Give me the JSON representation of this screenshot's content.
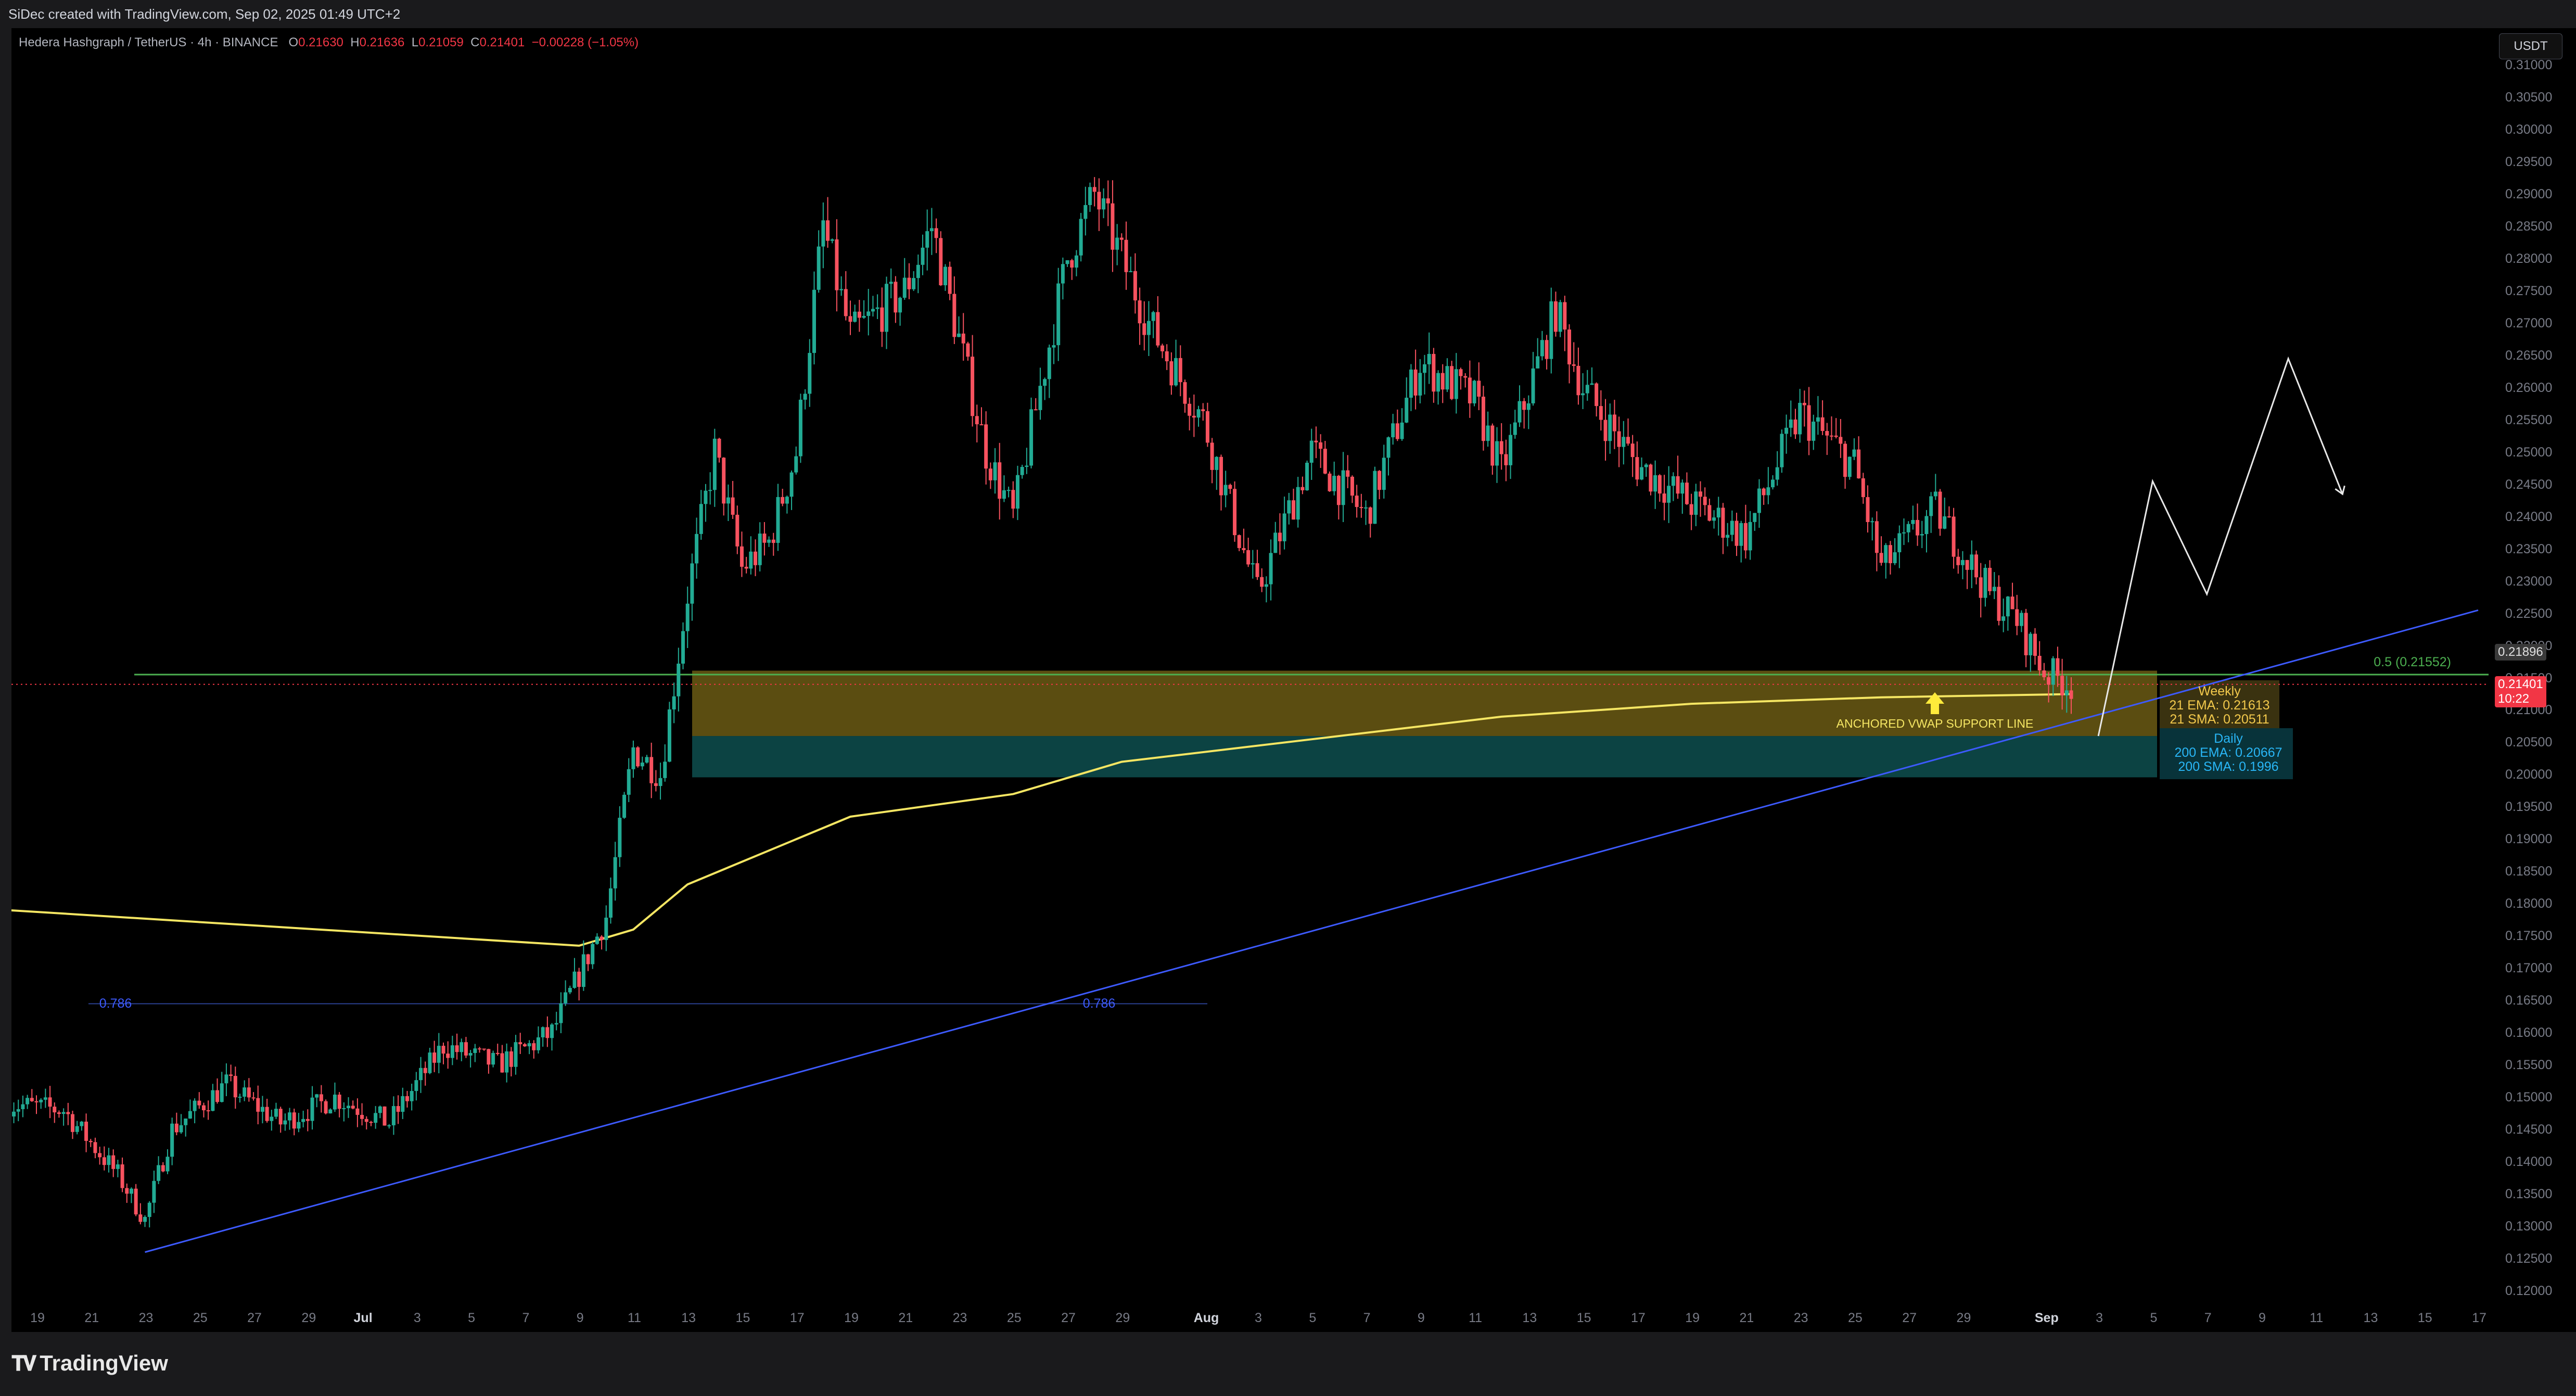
{
  "header": {
    "credit": "SiDec created with TradingView.com, Sep 02, 2025 01:49 UTC+2"
  },
  "symbol": {
    "title": "Hedera Hashgraph / TetherUS · 4h · BINANCE",
    "o_label": "O",
    "o": "0.21630",
    "h_label": "H",
    "h": "0.21636",
    "l_label": "L",
    "l": "0.21059",
    "c_label": "C",
    "c": "0.21401",
    "change": "−0.00228 (−1.05%)"
  },
  "price_axis": {
    "currency": "USDT",
    "ticks": [
      "0.31000",
      "0.30500",
      "0.30000",
      "0.29500",
      "0.29000",
      "0.28500",
      "0.28000",
      "0.27500",
      "0.27000",
      "0.26500",
      "0.26000",
      "0.25500",
      "0.25000",
      "0.24500",
      "0.24000",
      "0.23500",
      "0.23000",
      "0.22500",
      "0.22000",
      "0.21500",
      "0.21000",
      "0.20500",
      "0.20000",
      "0.19500",
      "0.19000",
      "0.18500",
      "0.18000",
      "0.17500",
      "0.17000",
      "0.16500",
      "0.16000",
      "0.15500",
      "0.15000",
      "0.14500",
      "0.14000",
      "0.13500",
      "0.13000",
      "0.12500",
      "0.12000"
    ],
    "marker_level": "0.21896",
    "marker_last": "0.21401",
    "marker_countdown": "10:22"
  },
  "time_axis": {
    "ticks": [
      "19",
      "21",
      "23",
      "25",
      "27",
      "29",
      "Jul",
      "3",
      "5",
      "7",
      "9",
      "11",
      "13",
      "15",
      "17",
      "19",
      "21",
      "23",
      "25",
      "27",
      "29",
      "Aug",
      "3",
      "5",
      "7",
      "9",
      "11",
      "13",
      "15",
      "17",
      "19",
      "21",
      "23",
      "25",
      "27",
      "29",
      "Sep",
      "3",
      "5",
      "7",
      "9",
      "11",
      "13",
      "15",
      "17"
    ]
  },
  "annotations": {
    "fib_label": "0.5 (0.21552)",
    "weekly_title": "Weekly",
    "weekly_ema": "21 EMA: 0.21613",
    "weekly_sma": "21 SMA: 0.20511",
    "daily_title": "Daily",
    "daily_ema": "200 EMA: 0.20667",
    "daily_sma": "200 SMA: 0.1996",
    "vwap_label": "ANCHORED VWAP SUPPORT LINE",
    "fib_786_left": "0.786",
    "fib_786_mid": "0.786"
  },
  "colors": {
    "bull": "#22ab94",
    "bear": "#f7525f",
    "vwap": "#f5e663",
    "trendline": "#3d5afe",
    "fib_green": "#4caf50",
    "weekly_zone": "#6b5a14",
    "daily_zone": "#0d4a4a",
    "background": "#000000"
  },
  "footer": {
    "brand": "TradingView",
    "brand_icon": "tradingview-logo-icon"
  },
  "chart_data": {
    "type": "candlestick",
    "title": "Hedera Hashgraph / TetherUS · 4h · BINANCE",
    "ylim": [
      0.118,
      0.312
    ],
    "x_range": [
      "2025-06-18",
      "2025-09-17"
    ],
    "close_path": [
      [
        "2025-06-18",
        0.149
      ],
      [
        "2025-06-20",
        0.148
      ],
      [
        "2025-06-22",
        0.138
      ],
      [
        "2025-06-23",
        0.131
      ],
      [
        "2025-06-24",
        0.145
      ],
      [
        "2025-06-26",
        0.152
      ],
      [
        "2025-06-28",
        0.146
      ],
      [
        "2025-06-30",
        0.15
      ],
      [
        "2025-07-02",
        0.146
      ],
      [
        "2025-07-04",
        0.158
      ],
      [
        "2025-07-06",
        0.155
      ],
      [
        "2025-07-08",
        0.16
      ],
      [
        "2025-07-10",
        0.178
      ],
      [
        "2025-07-11",
        0.204
      ],
      [
        "2025-07-12",
        0.2
      ],
      [
        "2025-07-13",
        0.228
      ],
      [
        "2025-07-14",
        0.25
      ],
      [
        "2025-07-15",
        0.232
      ],
      [
        "2025-07-16",
        0.236
      ],
      [
        "2025-07-17",
        0.25
      ],
      [
        "2025-07-18",
        0.285
      ],
      [
        "2025-07-19",
        0.268
      ],
      [
        "2025-07-21",
        0.275
      ],
      [
        "2025-07-22",
        0.285
      ],
      [
        "2025-07-24",
        0.25
      ],
      [
        "2025-07-25",
        0.24
      ],
      [
        "2025-07-27",
        0.28
      ],
      [
        "2025-07-28",
        0.29
      ],
      [
        "2025-07-30",
        0.27
      ],
      [
        "2025-08-01",
        0.255
      ],
      [
        "2025-08-03",
        0.228
      ],
      [
        "2025-08-05",
        0.25
      ],
      [
        "2025-08-07",
        0.24
      ],
      [
        "2025-08-09",
        0.264
      ],
      [
        "2025-08-11",
        0.258
      ],
      [
        "2025-08-12",
        0.247
      ],
      [
        "2025-08-14",
        0.272
      ],
      [
        "2025-08-15",
        0.26
      ],
      [
        "2025-08-17",
        0.248
      ],
      [
        "2025-08-19",
        0.242
      ],
      [
        "2025-08-21",
        0.237
      ],
      [
        "2025-08-23",
        0.256
      ],
      [
        "2025-08-25",
        0.248
      ],
      [
        "2025-08-26",
        0.232
      ],
      [
        "2025-08-28",
        0.241
      ],
      [
        "2025-08-30",
        0.228
      ],
      [
        "2025-08-31",
        0.224
      ],
      [
        "2025-09-01",
        0.216
      ],
      [
        "2025-09-02",
        0.214
      ]
    ],
    "vwap_path": [
      [
        "2025-06-18",
        0.179
      ],
      [
        "2025-07-09",
        0.1735
      ],
      [
        "2025-07-11",
        0.176
      ],
      [
        "2025-07-13",
        0.183
      ],
      [
        "2025-07-17",
        0.19
      ],
      [
        "2025-07-19",
        0.1935
      ],
      [
        "2025-07-25",
        0.197
      ],
      [
        "2025-07-29",
        0.202
      ],
      [
        "2025-08-05",
        0.2055
      ],
      [
        "2025-08-12",
        0.209
      ],
      [
        "2025-08-19",
        0.211
      ],
      [
        "2025-08-26",
        0.212
      ],
      [
        "2025-09-02",
        0.2125
      ]
    ],
    "trendline": [
      [
        "2025-06-23",
        0.126
      ],
      [
        "2025-09-17",
        0.2255
      ]
    ],
    "projection": [
      [
        "2025-09-03",
        0.206
      ],
      [
        "2025-09-05",
        0.2455
      ],
      [
        "2025-09-07",
        0.228
      ],
      [
        "2025-09-10",
        0.2645
      ],
      [
        "2025-09-12",
        0.2435
      ]
    ],
    "levels": {
      "fib_0_5": 0.21552,
      "fib_0_786": 0.1645,
      "last": 0.21401,
      "marker": 0.21896
    },
    "zones": {
      "weekly": [
        0.206,
        0.21613
      ],
      "daily": [
        0.1996,
        0.206
      ]
    }
  }
}
